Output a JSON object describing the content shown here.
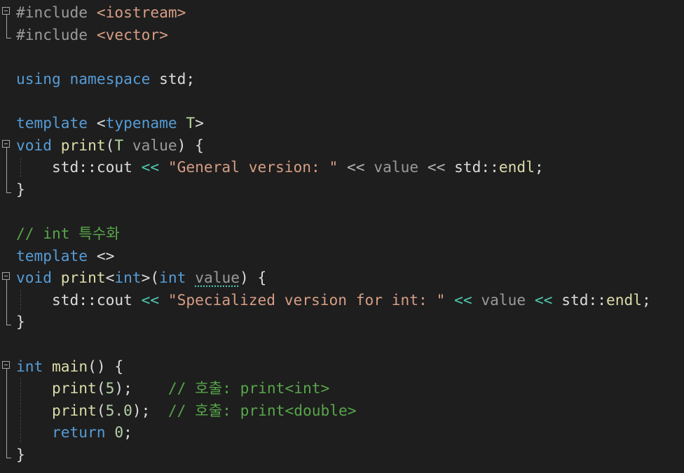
{
  "editor": {
    "lines": [
      {
        "tokens": [
          {
            "c": "pp",
            "t": "#include "
          },
          {
            "c": "inc",
            "t": "<iostream>"
          }
        ]
      },
      {
        "tokens": [
          {
            "c": "pp",
            "t": "#include "
          },
          {
            "c": "inc",
            "t": "<vector>"
          }
        ]
      },
      {
        "tokens": []
      },
      {
        "tokens": [
          {
            "c": "kw",
            "t": "using"
          },
          {
            "c": "txt",
            "t": " "
          },
          {
            "c": "kw",
            "t": "namespace"
          },
          {
            "c": "txt",
            "t": " std;"
          }
        ]
      },
      {
        "tokens": []
      },
      {
        "tokens": [
          {
            "c": "kw",
            "t": "template"
          },
          {
            "c": "txt",
            "t": " <"
          },
          {
            "c": "kw",
            "t": "typename"
          },
          {
            "c": "txt",
            "t": " "
          },
          {
            "c": "tp",
            "t": "T"
          },
          {
            "c": "txt",
            "t": ">"
          }
        ]
      },
      {
        "tokens": [
          {
            "c": "kw",
            "t": "void"
          },
          {
            "c": "txt",
            "t": " "
          },
          {
            "c": "fn",
            "t": "print"
          },
          {
            "c": "txt",
            "t": "("
          },
          {
            "c": "tp",
            "t": "T"
          },
          {
            "c": "txt",
            "t": " "
          },
          {
            "c": "prm",
            "t": "value"
          },
          {
            "c": "txt",
            "t": ") {"
          }
        ]
      },
      {
        "tokens": [
          {
            "c": "txt",
            "t": "    std::"
          },
          {
            "c": "txt",
            "t": "cout"
          },
          {
            "c": "txt",
            "t": " "
          },
          {
            "c": "opc",
            "t": "<<"
          },
          {
            "c": "txt",
            "t": " "
          },
          {
            "c": "str",
            "t": "\"General version: \""
          },
          {
            "c": "txt",
            "t": " "
          },
          {
            "c": "op",
            "t": "<<"
          },
          {
            "c": "txt",
            "t": " "
          },
          {
            "c": "prm",
            "t": "value"
          },
          {
            "c": "txt",
            "t": " "
          },
          {
            "c": "op",
            "t": "<<"
          },
          {
            "c": "txt",
            "t": " std::"
          },
          {
            "c": "fn",
            "t": "endl"
          },
          {
            "c": "txt",
            "t": ";"
          }
        ]
      },
      {
        "tokens": [
          {
            "c": "txt",
            "t": "}"
          }
        ]
      },
      {
        "tokens": []
      },
      {
        "tokens": [
          {
            "c": "cm",
            "t": "// int 특수화"
          }
        ]
      },
      {
        "tokens": [
          {
            "c": "kw",
            "t": "template"
          },
          {
            "c": "txt",
            "t": " <>"
          }
        ]
      },
      {
        "tokens": [
          {
            "c": "kw",
            "t": "void"
          },
          {
            "c": "txt",
            "t": " "
          },
          {
            "c": "fn",
            "t": "print"
          },
          {
            "c": "txt",
            "t": "<"
          },
          {
            "c": "kw",
            "t": "int"
          },
          {
            "c": "txt",
            "t": ">("
          },
          {
            "c": "kw",
            "t": "int"
          },
          {
            "c": "txt",
            "t": " "
          },
          {
            "c": "prm sq",
            "t": "value"
          },
          {
            "c": "txt",
            "t": ") {"
          }
        ]
      },
      {
        "tokens": [
          {
            "c": "txt",
            "t": "    std::"
          },
          {
            "c": "txt",
            "t": "cout"
          },
          {
            "c": "txt",
            "t": " "
          },
          {
            "c": "opc",
            "t": "<<"
          },
          {
            "c": "txt",
            "t": " "
          },
          {
            "c": "str",
            "t": "\"Specialized version for int: \""
          },
          {
            "c": "txt",
            "t": " "
          },
          {
            "c": "opc",
            "t": "<<"
          },
          {
            "c": "txt",
            "t": " "
          },
          {
            "c": "prm",
            "t": "value"
          },
          {
            "c": "txt",
            "t": " "
          },
          {
            "c": "opc",
            "t": "<<"
          },
          {
            "c": "txt",
            "t": " std::"
          },
          {
            "c": "fn",
            "t": "endl"
          },
          {
            "c": "txt",
            "t": ";"
          }
        ]
      },
      {
        "tokens": [
          {
            "c": "txt",
            "t": "}"
          }
        ]
      },
      {
        "tokens": []
      },
      {
        "tokens": [
          {
            "c": "kw",
            "t": "int"
          },
          {
            "c": "txt",
            "t": " "
          },
          {
            "c": "fn",
            "t": "main"
          },
          {
            "c": "txt",
            "t": "() {"
          }
        ]
      },
      {
        "tokens": [
          {
            "c": "txt",
            "t": "    "
          },
          {
            "c": "fn",
            "t": "print"
          },
          {
            "c": "txt",
            "t": "("
          },
          {
            "c": "num",
            "t": "5"
          },
          {
            "c": "txt",
            "t": ");    "
          },
          {
            "c": "cm",
            "t": "// 호출: print<int>"
          }
        ]
      },
      {
        "tokens": [
          {
            "c": "txt",
            "t": "    "
          },
          {
            "c": "fn",
            "t": "print"
          },
          {
            "c": "txt",
            "t": "("
          },
          {
            "c": "num",
            "t": "5.0"
          },
          {
            "c": "txt",
            "t": ");  "
          },
          {
            "c": "cm",
            "t": "// 호출: print<double>"
          }
        ]
      },
      {
        "tokens": [
          {
            "c": "txt",
            "t": "    "
          },
          {
            "c": "kw",
            "t": "return"
          },
          {
            "c": "txt",
            "t": " "
          },
          {
            "c": "num",
            "t": "0"
          },
          {
            "c": "txt",
            "t": ";"
          }
        ]
      },
      {
        "tokens": [
          {
            "c": "txt",
            "t": "}"
          }
        ]
      }
    ]
  }
}
